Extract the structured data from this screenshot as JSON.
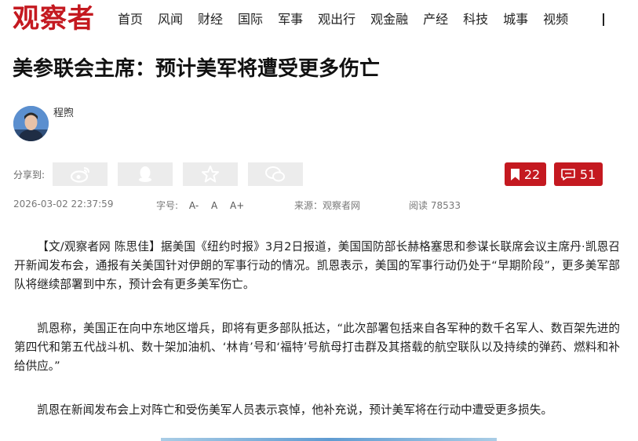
{
  "header": {
    "logo": "观察者",
    "nav": [
      "首页",
      "风闻",
      "财经",
      "国际",
      "军事",
      "观出行",
      "观金融",
      "产经",
      "科技",
      "城事",
      "视频"
    ]
  },
  "article": {
    "title": "美参联会主席：预计美军将遭受更多伤亡",
    "author": "程煦",
    "share_label": "分享到:",
    "share_icons": [
      "weibo-icon",
      "qq-icon",
      "qzone-star-icon",
      "wechat-icon"
    ],
    "bookmark_count": "22",
    "comment_count": "51",
    "datetime": "2026-03-02 22:37:59",
    "font_label": "字号:",
    "font_sizes": [
      "A-",
      "A",
      "A+"
    ],
    "source": "来源：观察者网",
    "reads": "阅读 78533",
    "paragraphs": [
      "【文/观察者网 陈思佳】据美国《纽约时报》3月2日报道，美国国防部长赫格塞思和参谋长联席会议主席丹·凯恩召开新闻发布会，通报有关美国针对伊朗的军事行动的情况。凯恩表示，美国的军事行动仍处于“早期阶段”，更多美军部队将继续部署到中东，预计会有更多美军伤亡。",
      "凯恩称，美国正在向中东地区增兵，即将有更多部队抵达，“此次部署包括来自各军种的数千名军人、数百架先进的第四代和第五代战斗机、数十架加油机、‘林肯’号和‘福特’号航母打击群及其搭载的航空联队以及持续的弹药、燃料和补给供应。”",
      "凯恩在新闻发布会上对阵亡和受伤美军人员表示哀悼，他补充说，预计美军将在行动中遭受更多损失。"
    ]
  },
  "colors": {
    "brand_red": "#c41920",
    "share_bg": "#ececec",
    "meta_gray": "#777777"
  }
}
